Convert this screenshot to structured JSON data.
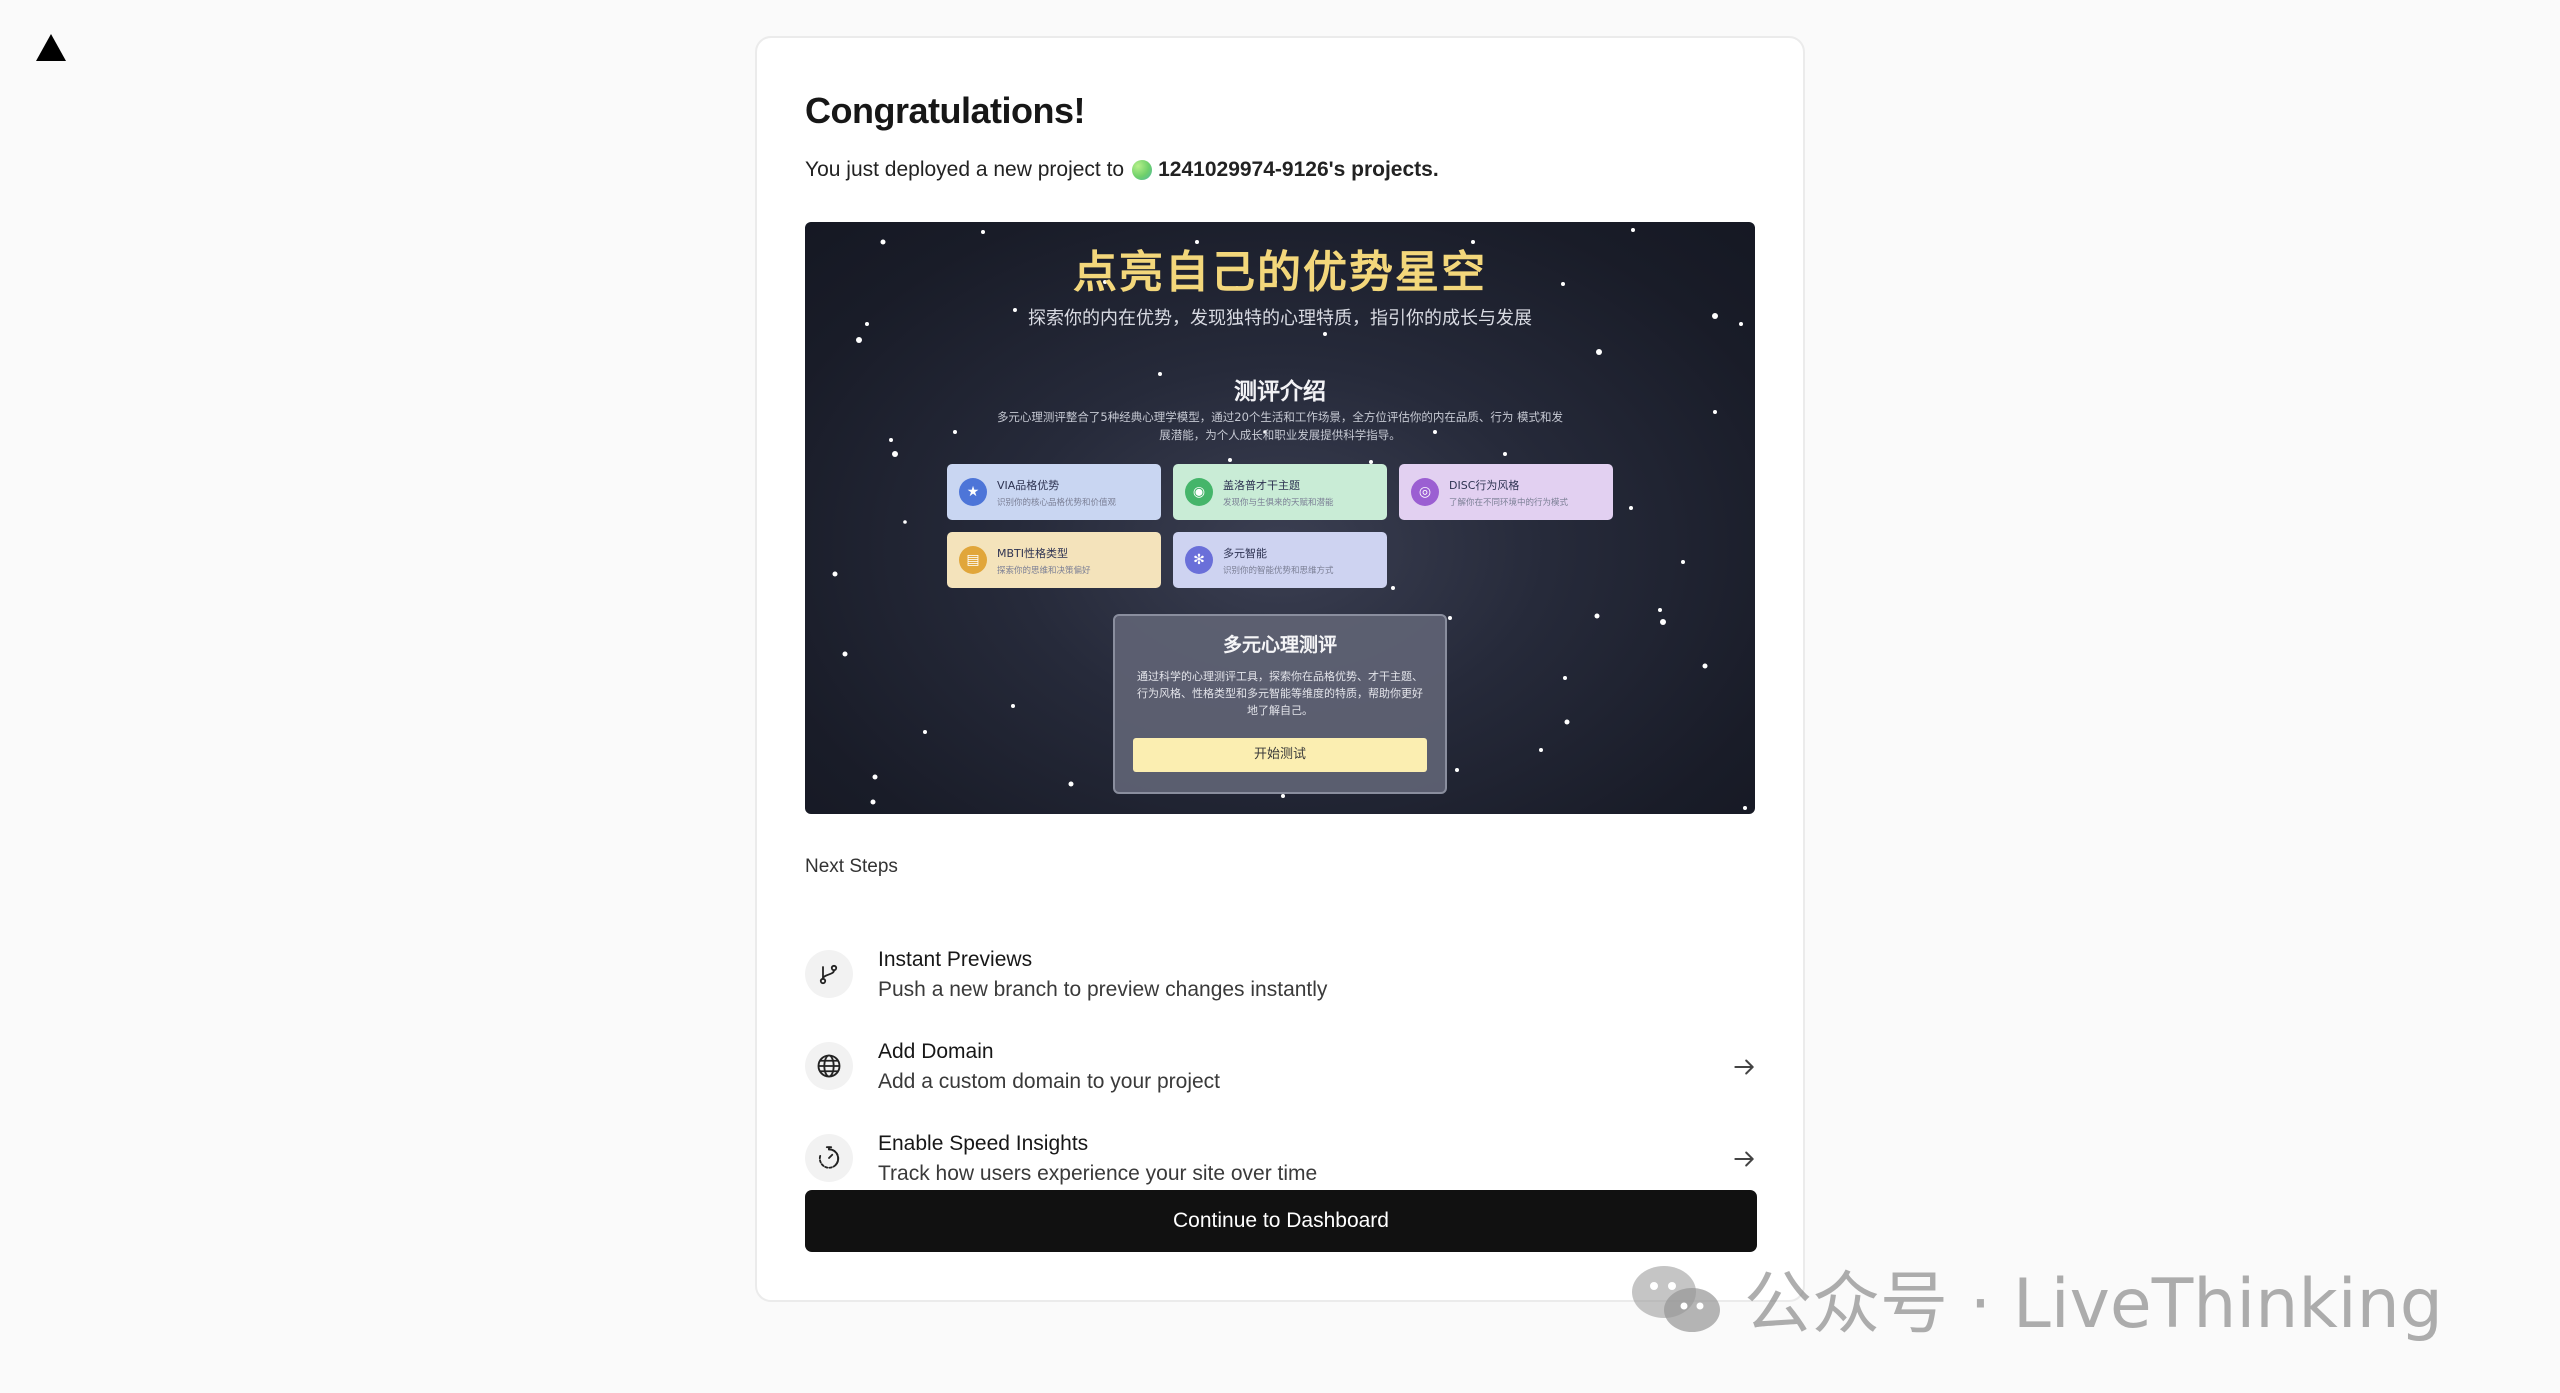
{
  "header": {
    "logo_icon": "vercel-triangle-icon"
  },
  "card": {
    "title": "Congratulations!",
    "subtitle_prefix": "You just deployed a new project to",
    "team_name": "1241029974-9126's projects."
  },
  "preview": {
    "title": "点亮自己的优势星空",
    "subtitle": "探索你的内在优势，发现独特的心理特质，指引你的成长与发展",
    "section_title": "测评介绍",
    "description": "多元心理测评整合了5种经典心理学模型，通过20个生活和工作场景，全方位评估你的内在品质、行为 模式和发展潜能，为个人成长和职业发展提供科学指导。",
    "tags": [
      {
        "title": "VIA品格优势",
        "desc": "识别你的核心品格优势和价值观",
        "icon": "award-icon"
      },
      {
        "title": "盖洛普才干主题",
        "desc": "发现你与生俱来的天赋和潜能",
        "icon": "lightbulb-icon"
      },
      {
        "title": "DISC行为风格",
        "desc": "了解你在不同环境中的行为模式",
        "icon": "target-icon"
      },
      {
        "title": "MBTI性格类型",
        "desc": "探索你的思维和决策偏好",
        "icon": "document-icon"
      },
      {
        "title": "多元智能",
        "desc": "识别你的智能优势和思维方式",
        "icon": "brain-icon"
      }
    ],
    "box": {
      "title": "多元心理测评",
      "desc": "通过科学的心理测评工具，探索你在品格优势、才干主题、行为风格、性格类型和多元智能等维度的特质，帮助你更好地了解自己。",
      "button": "开始测试"
    }
  },
  "next_steps": {
    "label": "Next Steps",
    "items": [
      {
        "title": "Instant Previews",
        "desc": "Push a new branch to preview changes instantly",
        "icon": "git-branch-icon"
      },
      {
        "title": "Add Domain",
        "desc": "Add a custom domain to your project",
        "icon": "globe-icon"
      },
      {
        "title": "Enable Speed Insights",
        "desc": "Track how users experience your site over time",
        "icon": "speed-timer-icon"
      }
    ]
  },
  "cta": {
    "label": "Continue to Dashboard"
  },
  "watermark": {
    "text": "公众号 · LiveThinking",
    "icon": "wechat-icon"
  }
}
